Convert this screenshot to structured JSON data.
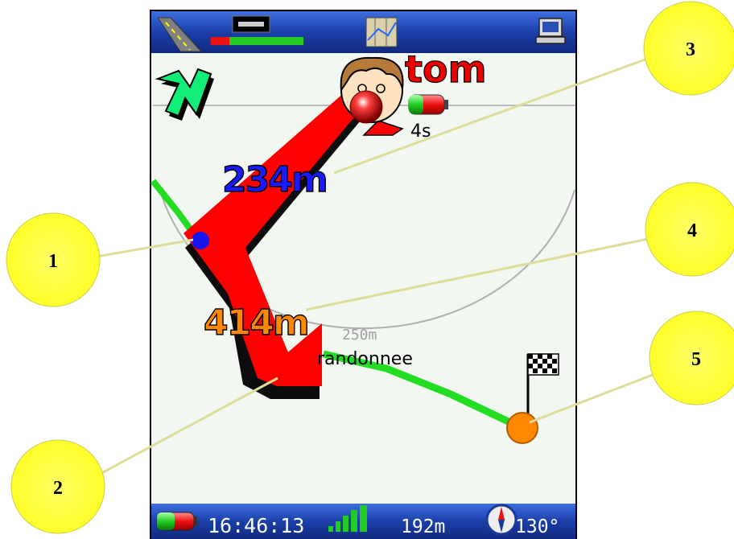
{
  "colors": {
    "bar_blue": "#1b3fa8",
    "bar_blue_light": "#3f6fe0",
    "map_bg": "#f3f7f2",
    "route_red": "#ff0000",
    "track_green": "#22dd22",
    "callout_yellow": "#ffff33",
    "dist_blue": "#1a1aff",
    "dist_orange": "#ff8800",
    "goal_orange": "#ff8800"
  },
  "top_bar": {
    "icons": [
      "road-icon",
      "gps-receiver-icon",
      "map-icon",
      "computer-icon"
    ],
    "signal_level": 0.2
  },
  "map": {
    "contact_name": "tom",
    "contact_age": "4s",
    "distance_to_contact": "234m",
    "distance_to_goal": "414m",
    "circle_radius_label": "250m",
    "track_name": "randonnee"
  },
  "status_bar": {
    "time": "16:46:13",
    "altitude": "192m",
    "heading": "130°",
    "gps_signal_bars": 5
  },
  "callouts": [
    "1",
    "2",
    "3",
    "4",
    "5"
  ]
}
